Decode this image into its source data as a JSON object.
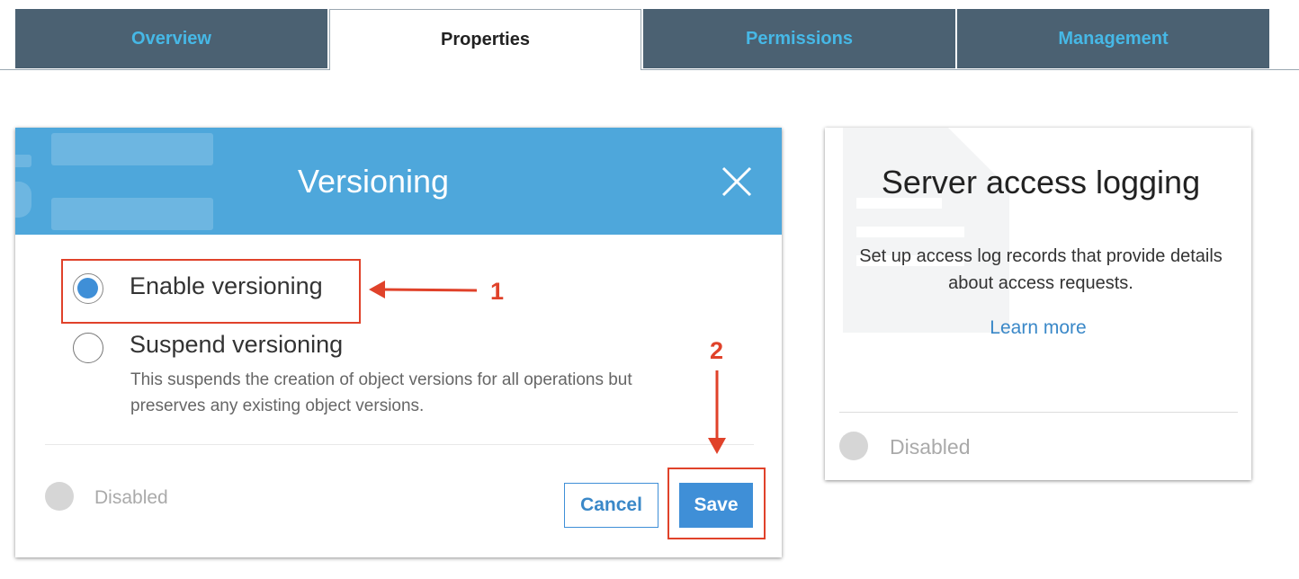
{
  "tabs": {
    "overview": "Overview",
    "properties": "Properties",
    "permissions": "Permissions",
    "management": "Management"
  },
  "versioning": {
    "title": "Versioning",
    "enable_label": "Enable versioning",
    "suspend_label": "Suspend versioning",
    "suspend_description": "This suspends the creation of object versions for all operations but preserves any existing object versions.",
    "selected_option": "enable",
    "status": "Disabled",
    "cancel_label": "Cancel",
    "save_label": "Save"
  },
  "logging": {
    "title": "Server access logging",
    "description": "Set up access log records that provide details about access requests.",
    "learn_more": "Learn more",
    "status": "Disabled"
  },
  "annotations": {
    "step1": "1",
    "step2": "2"
  },
  "colors": {
    "tab_bg": "#4b6172",
    "tab_text": "#46b8e6",
    "header_blue": "#4ea7db",
    "primary": "#3f8fd7",
    "annotation_red": "#e0422a"
  },
  "icons": {
    "close": "close-icon",
    "log_background": "document-icon"
  }
}
